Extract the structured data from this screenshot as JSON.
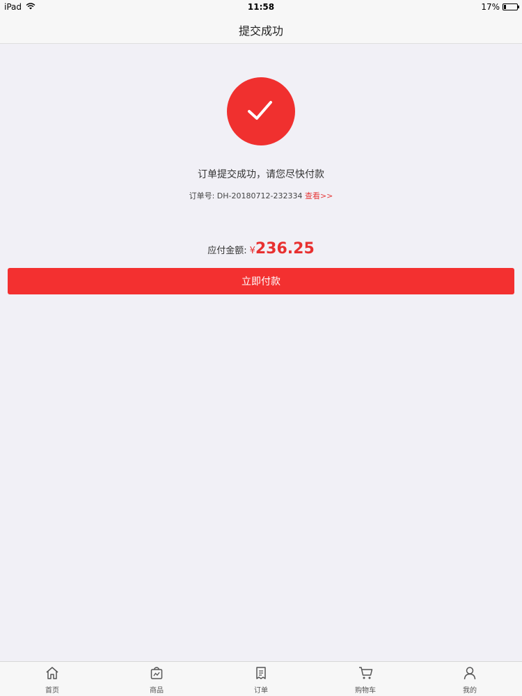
{
  "status_bar": {
    "device": "iPad",
    "time": "11:58",
    "battery": "17%",
    "battery_level": 0.17
  },
  "nav": {
    "title": "提交成功"
  },
  "success": {
    "message": "订单提交成功，请您尽快付款",
    "order_label": "订单号:",
    "order_number": "DH-20180712-232334",
    "view_link": "查看>>"
  },
  "payment": {
    "amount_label": "应付金额:",
    "currency": "¥",
    "amount": "236.25",
    "pay_button": "立即付款"
  },
  "tabs": [
    {
      "label": "首页",
      "icon": "home-icon"
    },
    {
      "label": "商品",
      "icon": "shopping-bag-icon"
    },
    {
      "label": "订单",
      "icon": "receipt-icon"
    },
    {
      "label": "购物车",
      "icon": "cart-icon"
    },
    {
      "label": "我的",
      "icon": "user-icon"
    }
  ],
  "colors": {
    "accent": "#f33030",
    "background": "#f1f0f6"
  }
}
